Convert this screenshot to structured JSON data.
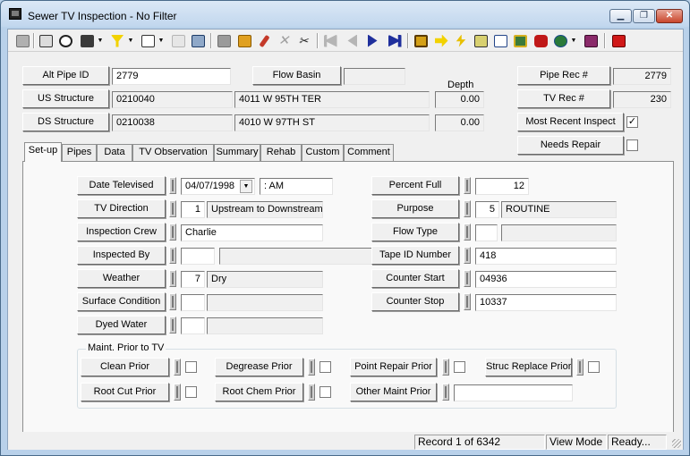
{
  "window": {
    "title": "Sewer TV Inspection - No Filter",
    "minimize": "▁",
    "restore": "❐",
    "close": "✕"
  },
  "toolbar": {
    "icons": [
      "new-icon",
      "print-icon",
      "print-preview-icon",
      "tools-icon",
      "filter-icon",
      "report-icon",
      "copy-icon",
      "save-icon",
      "edit-icon",
      "pencil-icon",
      "delete-icon",
      "cut-icon",
      "first-record-icon",
      "previous-record-icon",
      "next-record-icon",
      "last-record-icon",
      "find-icon",
      "goto-icon",
      "lightning-icon",
      "map-icon",
      "tree-icon",
      "image-icon",
      "video-icon",
      "globe-icon",
      "book-icon",
      "exit-icon"
    ],
    "arrow": "▼"
  },
  "header": {
    "alt_pipe_id_label": "Alt Pipe ID",
    "alt_pipe_id": "2779",
    "flow_basin_label": "Flow Basin",
    "flow_basin": "",
    "depth_label": "Depth",
    "us_structure_label": "US Structure",
    "us_structure_id": "0210040",
    "us_structure_addr": "4011  W  95TH TER",
    "us_depth": "0.00",
    "ds_structure_label": "DS Structure",
    "ds_structure_id": "0210038",
    "ds_structure_addr": "4010  W 97TH ST",
    "ds_depth": "0.00",
    "pipe_rec_label": "Pipe Rec #",
    "pipe_rec": "2779",
    "tv_rec_label": "TV Rec #",
    "tv_rec": "230",
    "most_recent_label": "Most Recent Inspect",
    "most_recent_checked": "✓",
    "needs_repair_label": "Needs Repair",
    "needs_repair_checked": ""
  },
  "tabs": [
    "Set-up",
    "Pipes",
    "Data",
    "TV Observation",
    "Summary",
    "Rehab",
    "Custom",
    "Comment"
  ],
  "setup": {
    "date_televised_label": "Date Televised",
    "date_televised": "04/07/1998",
    "time": "  :  AM",
    "dropdown": "▼",
    "tv_direction_label": "TV Direction",
    "tv_direction_code": "1",
    "tv_direction": "Upstream to Downstream",
    "crew_label": "Inspection Crew",
    "crew": "Charlie",
    "inspected_by_label": "Inspected By",
    "inspected_by_code": "",
    "inspected_by": "",
    "weather_label": "Weather",
    "weather_code": "7",
    "weather": "Dry",
    "surface_label": "Surface Condition",
    "surface_code": "",
    "surface": "",
    "dyed_label": "Dyed Water",
    "dyed_code": "",
    "dyed": "",
    "percent_full_label": "Percent Full",
    "percent_full": "12",
    "purpose_label": "Purpose",
    "purpose_code": "5",
    "purpose": "ROUTINE",
    "flow_type_label": "Flow Type",
    "flow_type_code": "",
    "flow_type": "",
    "tape_id_label": "Tape ID Number",
    "tape_id": "418",
    "counter_start_label": "Counter Start",
    "counter_start": "04936",
    "counter_stop_label": "Counter Stop",
    "counter_stop": "10337"
  },
  "maint": {
    "legend": "Maint. Prior to TV",
    "clean_prior": "Clean Prior",
    "degrease_prior": "Degrease Prior",
    "point_repair_prior": "Point Repair Prior",
    "struc_replace_prior": "Struc Replace Prior",
    "root_cut_prior": "Root Cut Prior",
    "root_chem_prior": "Root Chem Prior",
    "other_maint_prior": "Other Maint Prior",
    "other_maint_value": ""
  },
  "status": {
    "record": "Record 1 of 6342",
    "mode": "View Mode",
    "state": "Ready..."
  },
  "colors": {
    "titlebar": "#c2d7ee",
    "panel": "#f9f9f9",
    "client": "#f0f0f0"
  }
}
